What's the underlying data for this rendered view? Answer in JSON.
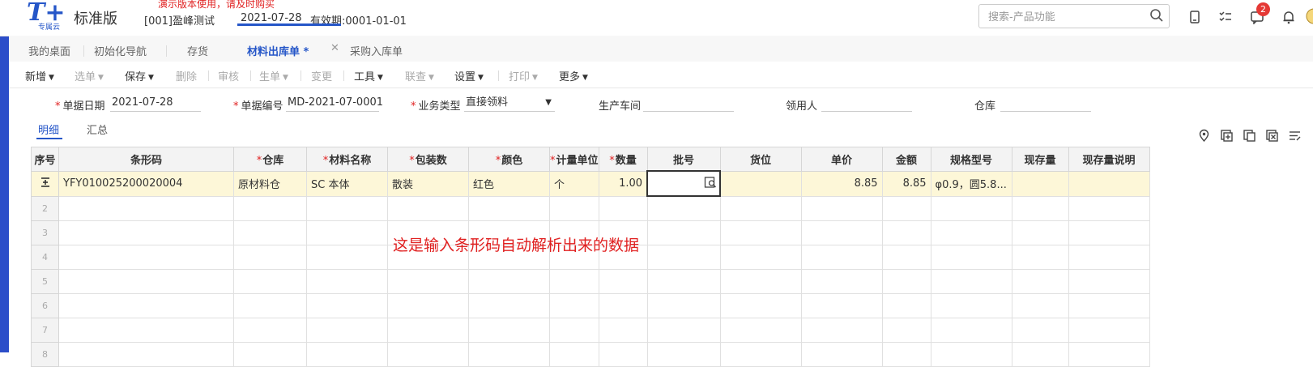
{
  "header": {
    "logo_text": "T+",
    "logo_sub": "专属云",
    "edition": "标准版",
    "demo_notice": "演示版本使用，请及时购买",
    "account": "[001]盈峰测试",
    "date": "2021-07-28",
    "validity": "有效期:0001-01-01",
    "search_placeholder": "搜索-产品功能",
    "notification_count": "2"
  },
  "tabs": [
    {
      "label": "我的桌面"
    },
    {
      "label": "初始化导航"
    },
    {
      "label": "存货"
    },
    {
      "label": "材料出库单 *"
    },
    {
      "label": "采购入库单"
    }
  ],
  "toolbar": [
    {
      "label": "新增",
      "enabled": true
    },
    {
      "label": "选单",
      "enabled": false
    },
    {
      "label": "保存",
      "enabled": true
    },
    {
      "label": "删除",
      "enabled": false
    },
    {
      "label": "审核",
      "enabled": false
    },
    {
      "label": "生单",
      "enabled": false
    },
    {
      "label": "变更",
      "enabled": false
    },
    {
      "label": "工具",
      "enabled": true
    },
    {
      "label": "联查",
      "enabled": false
    },
    {
      "label": "设置",
      "enabled": true
    },
    {
      "label": "打印",
      "enabled": false
    },
    {
      "label": "更多",
      "enabled": true
    }
  ],
  "form": {
    "doc_date": {
      "label": "单据日期",
      "value": "2021-07-28"
    },
    "doc_no": {
      "label": "单据编号",
      "value": "MD-2021-07-0001"
    },
    "biz_type": {
      "label": "业务类型",
      "value": "直接领料"
    },
    "workshop": {
      "label": "生产车间",
      "value": ""
    },
    "recipient": {
      "label": "领用人",
      "value": ""
    },
    "warehouse": {
      "label": "仓库",
      "value": ""
    }
  },
  "subtabs": {
    "detail": "明细",
    "summary": "汇总"
  },
  "grid": {
    "columns": [
      "序号",
      "条形码",
      "仓库",
      "材料名称",
      "包装数",
      "颜色",
      "计量单位",
      "数量",
      "批号",
      "货位",
      "单价",
      "金额",
      "规格型号",
      "现存量",
      "现存量说明"
    ],
    "rows": [
      {
        "barcode": "YFY010025200020004",
        "warehouse": "原材料仓",
        "material": "SC 本体",
        "package": "散装",
        "color": "红色",
        "unit": "个",
        "qty": "1.00",
        "batch": "",
        "location": "",
        "price": "8.85",
        "amount": "8.85",
        "spec": "φ0.9，圆5.8...",
        "stock": "",
        "stock_note": ""
      }
    ],
    "empty_row_numbers": [
      "2",
      "3",
      "4",
      "5",
      "6",
      "7",
      "8"
    ]
  },
  "annotation": "这是输入条形码自动解析出来的数据",
  "colors": {
    "accent": "#2556c8",
    "required": "#e02020",
    "selected_row": "#fdf7d8",
    "sidebar": "#2c4ec9"
  }
}
